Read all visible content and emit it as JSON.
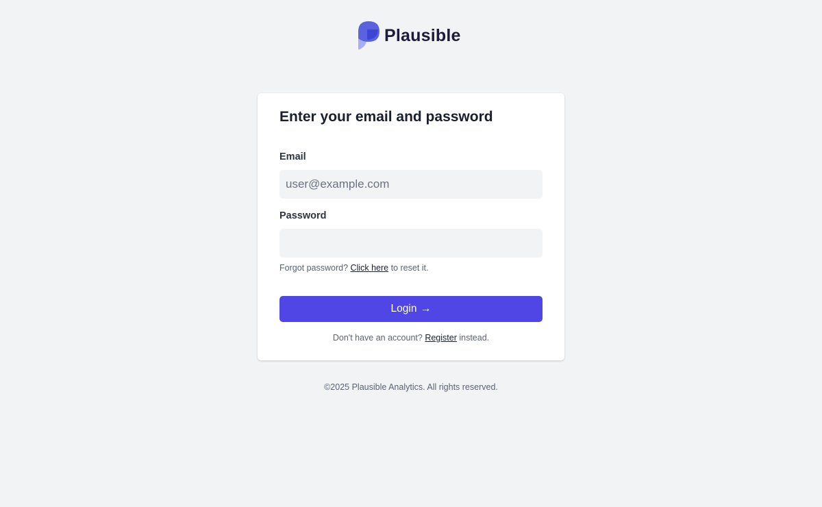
{
  "brand": {
    "name": "Plausible",
    "logo_icon": "plausible-logo-icon",
    "colors": {
      "primary": "#5b62e0",
      "secondary": "#9aa0ee"
    }
  },
  "login_card": {
    "title": "Enter your email and password",
    "email": {
      "label": "Email",
      "placeholder": "user@example.com",
      "value": ""
    },
    "password": {
      "label": "Password",
      "value": ""
    },
    "forgot": {
      "prefix": "Forgot password?",
      "link_text": "Click here",
      "suffix": "to reset it."
    },
    "login_button": {
      "label": "Login",
      "icon": "arrow-right-icon",
      "arrow": "→",
      "color": "#4f46e5"
    },
    "register": {
      "prefix": "Don't have an account?",
      "link_text": "Register",
      "suffix": "instead."
    }
  },
  "footer": {
    "text": "©2025 Plausible Analytics. All rights reserved."
  }
}
